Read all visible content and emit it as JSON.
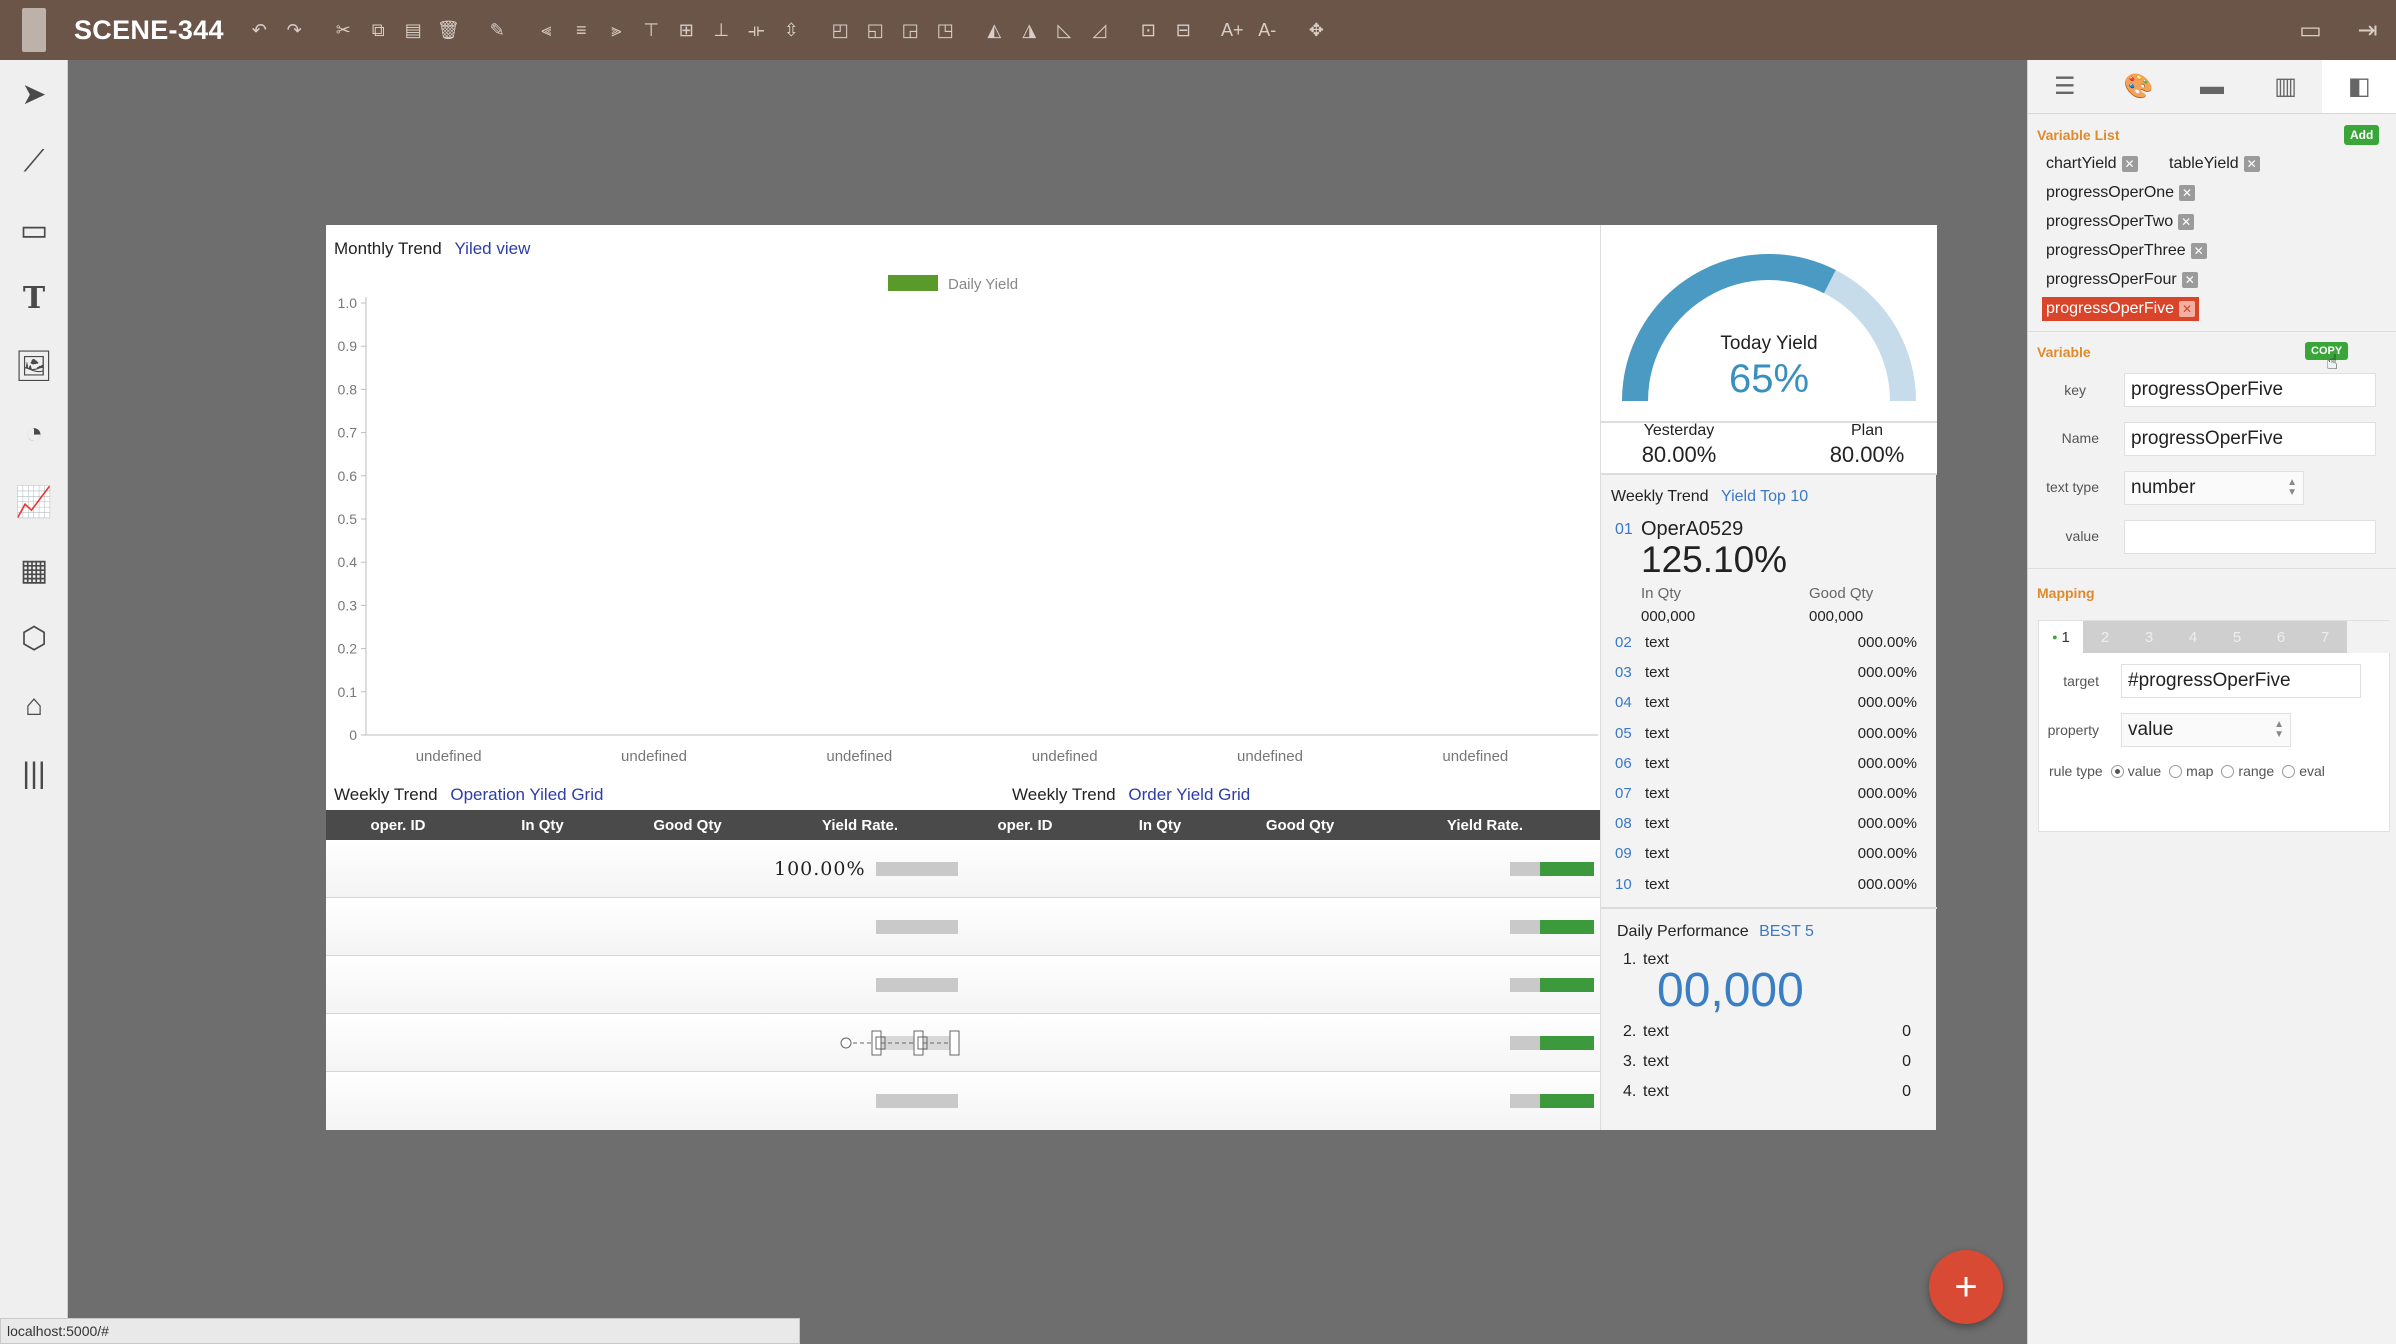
{
  "app": {
    "title": "SCENE-344"
  },
  "toolbar": {
    "icons": [
      "undo-icon",
      "redo-icon",
      "cut-icon",
      "copy-icon",
      "paste-icon",
      "delete-icon",
      "format-painter-icon",
      "align-left-icon",
      "align-center-icon",
      "align-right-icon",
      "align-top-icon",
      "align-middle-icon",
      "align-bottom-icon",
      "distribute-horizontal-icon",
      "distribute-vertical-icon",
      "bring-front-icon",
      "bring-forward-icon",
      "send-backward-icon",
      "send-back-icon",
      "flip-horizontal-icon",
      "flip-vertical-icon",
      "rotate-left-icon",
      "rotate-right-icon",
      "group-icon",
      "ungroup-icon",
      "font-increase-icon",
      "font-decrease-icon",
      "move-icon"
    ],
    "font_increase": "A+",
    "font_decrease": "A-"
  },
  "left_tools": [
    "select-add-icon",
    "line-icon",
    "shape-icon",
    "text-icon",
    "image-icon",
    "gauge-icon",
    "chart-icon",
    "table-icon",
    "3d-icon",
    "warehouse-icon",
    "barcode-icon"
  ],
  "left_tool_text": "T",
  "dashboard": {
    "chart_panel": {
      "title": "Monthly Trend",
      "link": "Yiled view"
    },
    "op_grid": {
      "title": "Weekly Trend",
      "link": "Operation Yiled Grid"
    },
    "order_grid": {
      "title": "Weekly Trend",
      "link": "Order Yield Grid"
    },
    "grid_columns": [
      "oper. ID",
      "In Qty",
      "Good Qty",
      "Yield Rate.",
      "oper. ID",
      "In Qty",
      "Good Qty",
      "Yield Rate."
    ],
    "grid_first_value": "100.00%",
    "today_yield": {
      "label": "Today Yield",
      "value": "65%",
      "progress": 0.65
    },
    "yesterday": {
      "label": "Yesterday",
      "value": "80.00%"
    },
    "plan": {
      "label": "Plan",
      "value": "80.00%"
    },
    "top10": {
      "title": "Weekly Trend",
      "link": "Yield Top 10",
      "first": {
        "rank": "01",
        "name": "OperA0529",
        "value": "125.10%",
        "in_label": "In Qty",
        "in_value": "000,000",
        "good_label": "Good Qty",
        "good_value": "000,000"
      },
      "rows": [
        {
          "rank": "02",
          "name": "text",
          "value": "000.00%"
        },
        {
          "rank": "03",
          "name": "text",
          "value": "000.00%"
        },
        {
          "rank": "04",
          "name": "text",
          "value": "000.00%"
        },
        {
          "rank": "05",
          "name": "text",
          "value": "000.00%"
        },
        {
          "rank": "06",
          "name": "text",
          "value": "000.00%"
        },
        {
          "rank": "07",
          "name": "text",
          "value": "000.00%"
        },
        {
          "rank": "08",
          "name": "text",
          "value": "000.00%"
        },
        {
          "rank": "09",
          "name": "text",
          "value": "000.00%"
        },
        {
          "rank": "10",
          "name": "text",
          "value": "000.00%"
        }
      ]
    },
    "daily_perf": {
      "title": "Daily Performance",
      "link": "BEST 5",
      "first": {
        "rank": "1.",
        "name": "text",
        "value": "00,000"
      },
      "rows": [
        {
          "rank": "2.",
          "name": "text",
          "value": "0"
        },
        {
          "rank": "3.",
          "name": "text",
          "value": "0"
        },
        {
          "rank": "4.",
          "name": "text",
          "value": "0"
        }
      ]
    }
  },
  "chart_data": {
    "type": "bar",
    "legend": [
      "Daily Yield"
    ],
    "categories": [
      "undefined",
      "undefined",
      "undefined",
      "undefined",
      "undefined",
      "undefined"
    ],
    "series": [
      {
        "name": "Daily Yield",
        "values": [
          0,
          0,
          0,
          0,
          0,
          0
        ]
      }
    ],
    "yticks": [
      "0",
      "0.1",
      "0.2",
      "0.3",
      "0.4",
      "0.5",
      "0.6",
      "0.7",
      "0.8",
      "0.9",
      "1.0"
    ],
    "ylim": [
      0,
      1.0
    ],
    "series_color": "#5a9a2a",
    "grid": false,
    "legend_position": "top-center"
  },
  "properties": {
    "tabs": [
      "list-icon",
      "palette-icon",
      "data-icon",
      "chart-icon",
      "property-icon"
    ],
    "variable_list": {
      "title": "Variable List",
      "add_label": "Add",
      "items": [
        "chartYield",
        "tableYield",
        "progressOperOne",
        "progressOperTwo",
        "progressOperThree",
        "progressOperFour",
        "progressOperFive"
      ],
      "selected": "progressOperFive"
    },
    "variable": {
      "title": "Variable",
      "copy_label": "COPY",
      "key_label": "key",
      "key_value": "progressOperFive",
      "name_label": "Name",
      "name_value": "progressOperFive",
      "text_type_label": "text type",
      "text_type_value": "number",
      "value_label": "value",
      "value_value": ""
    },
    "mapping": {
      "title": "Mapping",
      "tabs": [
        "1",
        "2",
        "3",
        "4",
        "5",
        "6",
        "7"
      ],
      "target_label": "target",
      "target_value": "#progressOperFive",
      "property_label": "property",
      "property_value": "value",
      "rule_type_label": "rule type",
      "rule_options": [
        "value",
        "map",
        "range",
        "eval"
      ],
      "rule_selected": "value"
    }
  },
  "status_url": "localhost:5000/#",
  "colors": {
    "accent": "#d9452a",
    "topbar": "#6a5548",
    "link": "#2d3da8",
    "gauge": "#4a9ac4",
    "gauge_track": "#c7dceb"
  }
}
